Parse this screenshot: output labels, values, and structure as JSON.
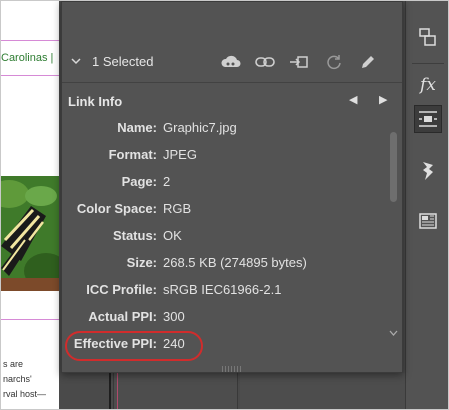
{
  "document": {
    "heading_fragment": "Carolinas |",
    "text_lines": [
      "s are",
      "narchs'",
      "rval host—"
    ]
  },
  "panel": {
    "selection_label": "1 Selected",
    "toolbar_icons": [
      "creative-cloud-icon",
      "relink-icon",
      "go-to-link-icon",
      "update-link-icon",
      "edit-original-icon"
    ],
    "section_title": "Link Info",
    "prev_glyph": "◀",
    "next_glyph": "▶",
    "info": [
      {
        "label": "Name:",
        "value": "Graphic7.jpg"
      },
      {
        "label": "Format:",
        "value": "JPEG"
      },
      {
        "label": "Page:",
        "value": "2"
      },
      {
        "label": "Color Space:",
        "value": "RGB"
      },
      {
        "label": "Status:",
        "value": "OK"
      },
      {
        "label": "Size:",
        "value": "268.5 KB (274895 bytes)"
      },
      {
        "label": "ICC Profile:",
        "value": "sRGB IEC61966-2.1"
      },
      {
        "label": "Actual PPI:",
        "value": "300"
      },
      {
        "label": "Effective PPI:",
        "value": "240"
      }
    ],
    "highlighted_row": "Effective PPI:"
  },
  "tool_strip": {
    "tools": [
      "arrange-icon",
      "fx-icon",
      "text-wrap-icon",
      "swatch-stack-icon",
      "table-icon"
    ],
    "active_tool": "text-wrap-icon"
  },
  "colors": {
    "panel_bg": "#535353",
    "text": "#e2e2e2",
    "highlight_ring": "#d12c2c",
    "doc_heading": "#2e7d32",
    "margin_guide": "#d68ad6"
  }
}
